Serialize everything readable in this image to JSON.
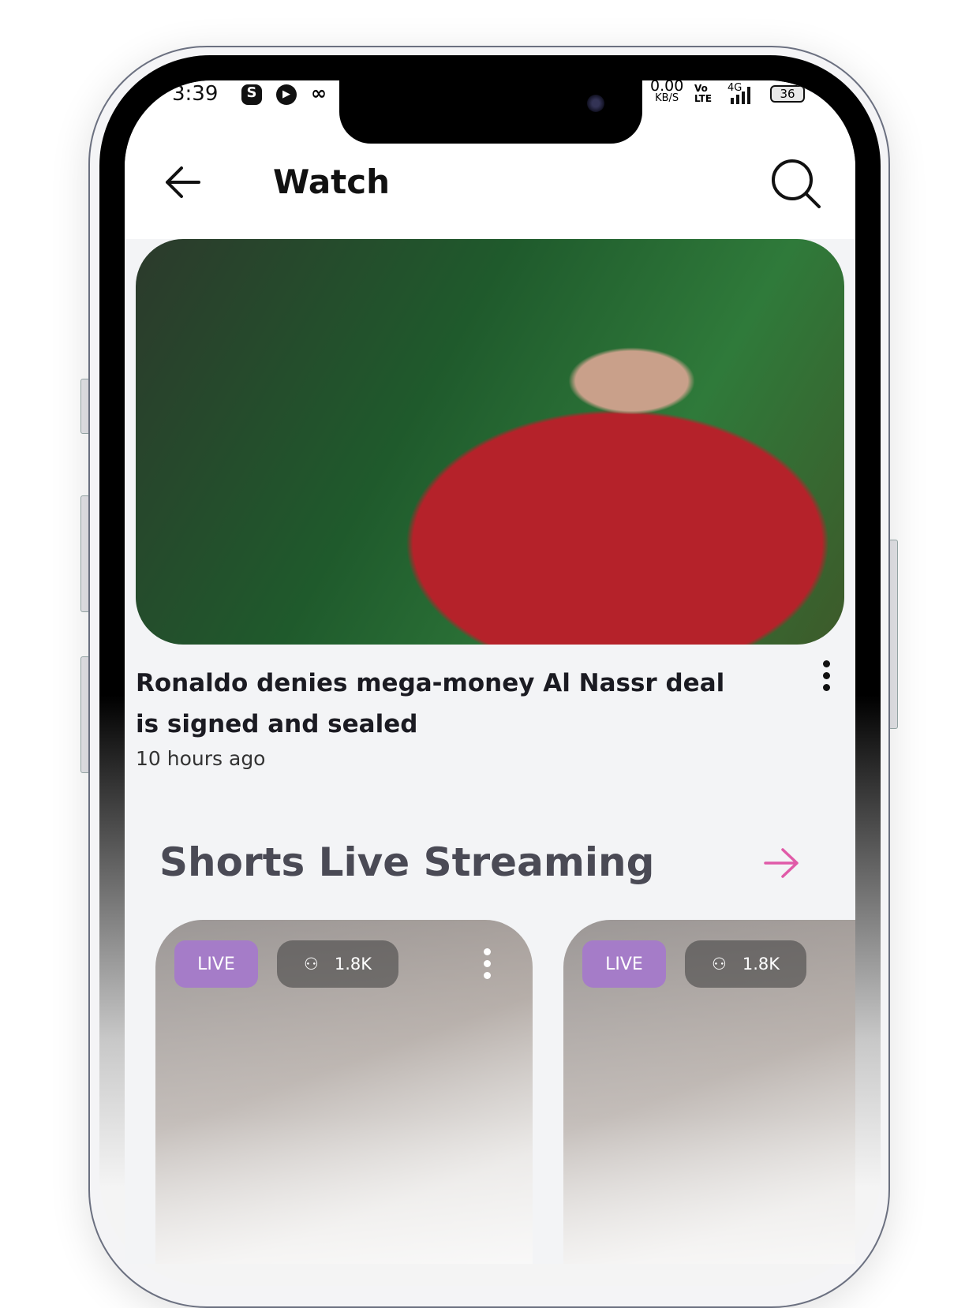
{
  "status_bar": {
    "time": "3:39",
    "net_speed": "0.00",
    "net_unit": "KB/S",
    "volte": "Vo LTE",
    "network": "4G",
    "battery": "36"
  },
  "header": {
    "title": "Watch",
    "back_icon": "arrow-left-icon",
    "search_icon": "search-icon"
  },
  "featured": {
    "headline": "Ronaldo denies mega-money Al Nassr deal is signed and sealed",
    "time": "10 hours ago"
  },
  "shorts": {
    "title": "Shorts Live Streaming",
    "accent": "#e05aa8",
    "cards": [
      {
        "badge": "LIVE",
        "viewers": "1.8K"
      },
      {
        "badge": "LIVE",
        "viewers": "1.8K"
      }
    ]
  }
}
